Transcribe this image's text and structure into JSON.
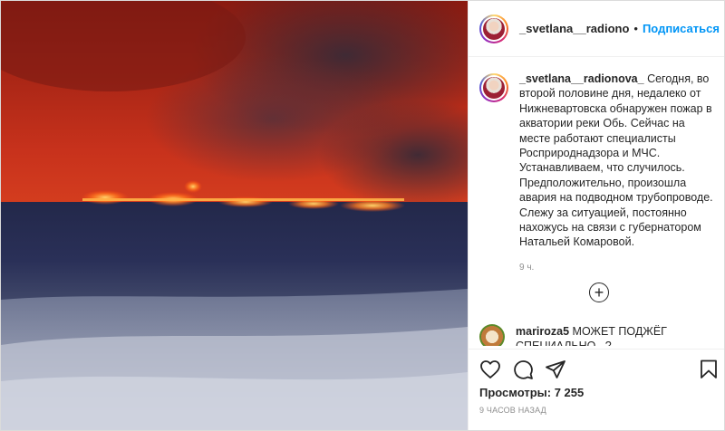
{
  "header": {
    "username": "_svetlana__radiono",
    "separator": "•",
    "follow_label": "Подписаться"
  },
  "caption": {
    "username": "_svetlana__radionova_",
    "text": "Сегодня, во второй половине дня, недалеко от Нижневартовска обнаружен пожар в акватории реки Обь. Сейчас на месте работают специалисты Росприроднадзора и МЧС. Устанавливаем, что случилось. Предположительно, произошла авария на подводном трубопроводе. Слежу за ситуацией, постоянно нахожусь на связи с губернатором Натальей Комаровой.",
    "time": "9 ч."
  },
  "load_more": {
    "icon": "plus-circle-icon",
    "symbol": "+"
  },
  "comment": {
    "username": "mariroza5",
    "text": "МОЖЕТ ПОДЖЁГ СПЕЦИАЛЬНО...?"
  },
  "actions": {
    "icons": [
      "heart-icon",
      "comment-icon",
      "share-icon",
      "bookmark-icon"
    ],
    "views_label": "Просмотры:",
    "views_count": "7 255",
    "posted_ago": "9 ЧАСОВ НАЗАД"
  },
  "colors": {
    "follow": "#0095f6",
    "text": "#262626",
    "muted": "#8e8e8e",
    "fire": "#ff6a1a"
  }
}
